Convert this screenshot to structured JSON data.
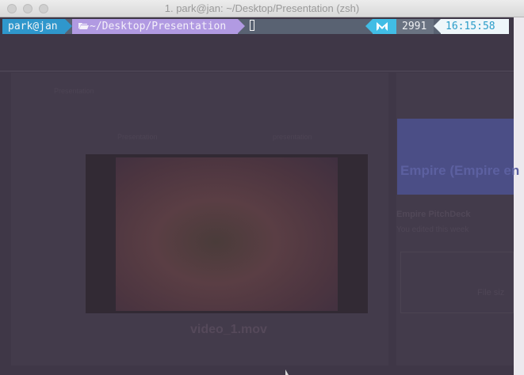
{
  "window": {
    "title": "1. park@jan: ~/Desktop/Presentation (zsh)"
  },
  "prompt": {
    "user_host": "park@jan",
    "path": "~/Desktop/Presentation",
    "history_icon": "m-logo-icon",
    "history_number": "2991",
    "time": "16:15:58"
  },
  "colors": {
    "user_segment": "#2f97cc",
    "path_segment": "#b19ae2",
    "history_icon_segment": "#41bde5",
    "time_segment_bg": "#eef6fa",
    "time_text": "#2b9dc9",
    "terminal_bg": "#3f3747"
  },
  "background": {
    "video_filename": "video_1.mov",
    "panel_title": "Empire (Empire en",
    "panel_item": "Empire PitchDeck",
    "panel_subtitle": "You edited this week",
    "file_label": "File siz",
    "toolbar_label_1": "Presentation",
    "toolbar_label_2": "presentation",
    "sidebar_label": "Presentation"
  }
}
